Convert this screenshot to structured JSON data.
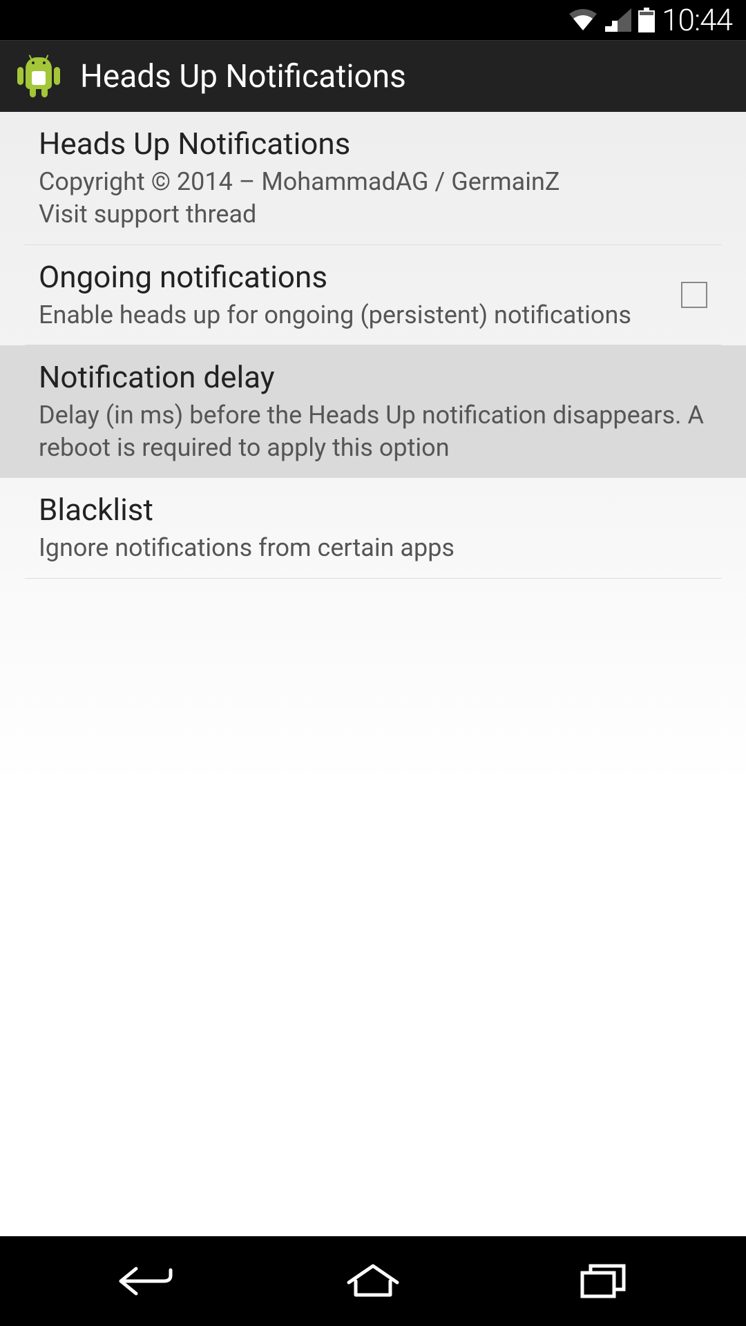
{
  "status_bar": {
    "time": "10:44"
  },
  "action_bar": {
    "title": "Heads Up Notifications"
  },
  "prefs": {
    "about": {
      "title": "Heads Up Notifications",
      "summary": "Copyright © 2014 – MohammadAG / GermainZ\nVisit support thread"
    },
    "ongoing": {
      "title": "Ongoing notifications",
      "summary": "Enable heads up for ongoing (persistent) notifications",
      "checked": false
    },
    "delay": {
      "title": "Notification delay",
      "summary": "Delay (in ms) before the Heads Up notification disappears. A reboot is required to apply this option"
    },
    "blacklist": {
      "title": "Blacklist",
      "summary": "Ignore notifications from certain apps"
    }
  }
}
